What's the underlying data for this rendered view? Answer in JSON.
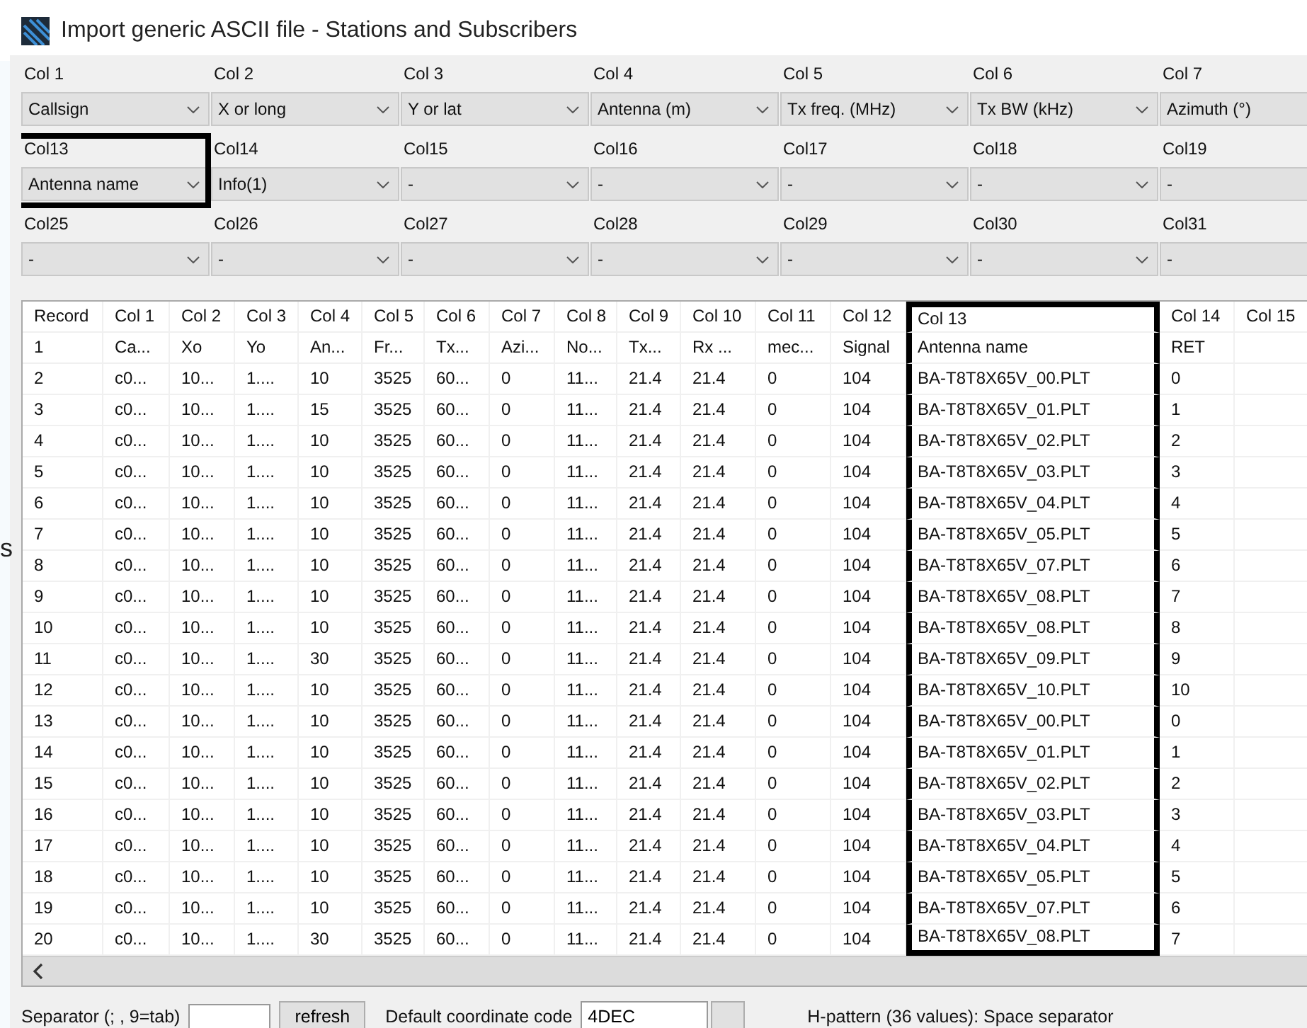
{
  "background_text": "s",
  "window": {
    "title": "Import generic ASCII file - Stations and Subscribers"
  },
  "column_mapping": [
    {
      "label": "Col 1",
      "value": "Callsign",
      "highlighted": false
    },
    {
      "label": "Col 2",
      "value": "X or long",
      "highlighted": false
    },
    {
      "label": "Col 3",
      "value": "Y or lat",
      "highlighted": false
    },
    {
      "label": "Col 4",
      "value": "Antenna (m)",
      "highlighted": false
    },
    {
      "label": "Col 5",
      "value": "Tx freq. (MHz)",
      "highlighted": false
    },
    {
      "label": "Col 6",
      "value": "Tx BW (kHz)",
      "highlighted": false
    },
    {
      "label": "Col 7",
      "value": "Azimuth (°)",
      "highlighted": false
    },
    {
      "label": "Col13",
      "value": "Antenna name",
      "highlighted": true
    },
    {
      "label": "Col14",
      "value": "Info(1)",
      "highlighted": false
    },
    {
      "label": "Col15",
      "value": "-",
      "highlighted": false
    },
    {
      "label": "Col16",
      "value": "-",
      "highlighted": false
    },
    {
      "label": "Col17",
      "value": "-",
      "highlighted": false
    },
    {
      "label": "Col18",
      "value": "-",
      "highlighted": false
    },
    {
      "label": "Col19",
      "value": "-",
      "highlighted": false
    },
    {
      "label": "Col25",
      "value": "-",
      "highlighted": false
    },
    {
      "label": "Col26",
      "value": "-",
      "highlighted": false
    },
    {
      "label": "Col27",
      "value": "-",
      "highlighted": false
    },
    {
      "label": "Col28",
      "value": "-",
      "highlighted": false
    },
    {
      "label": "Col29",
      "value": "-",
      "highlighted": false
    },
    {
      "label": "Col30",
      "value": "-",
      "highlighted": false
    },
    {
      "label": "Col31",
      "value": "-",
      "highlighted": false
    }
  ],
  "table": {
    "columns": [
      {
        "label": "Record",
        "highlighted": false
      },
      {
        "label": "Col 1",
        "highlighted": false
      },
      {
        "label": "Col 2",
        "highlighted": false
      },
      {
        "label": "Col 3",
        "highlighted": false
      },
      {
        "label": "Col 4",
        "highlighted": false
      },
      {
        "label": "Col 5",
        "highlighted": false
      },
      {
        "label": "Col 6",
        "highlighted": false
      },
      {
        "label": "Col 7",
        "highlighted": false
      },
      {
        "label": "Col 8",
        "highlighted": false
      },
      {
        "label": "Col 9",
        "highlighted": false
      },
      {
        "label": "Col 10",
        "highlighted": false
      },
      {
        "label": "Col 11",
        "highlighted": false
      },
      {
        "label": "Col 12",
        "highlighted": false
      },
      {
        "label": "Col 13",
        "highlighted": true
      },
      {
        "label": "Col 14",
        "highlighted": false
      },
      {
        "label": "Col 15",
        "highlighted": false
      }
    ],
    "rows": [
      [
        "1",
        "Ca...",
        "Xo",
        "Yo",
        "An...",
        "Fr...",
        "Tx...",
        "Azi...",
        "No...",
        "Tx...",
        "Rx ...",
        "mec...",
        "Signal",
        "Antenna name",
        "RET"
      ],
      [
        "2",
        "c0...",
        "10...",
        "1....",
        "10",
        "3525",
        "60...",
        "0",
        "11...",
        "21.4",
        "21.4",
        "0",
        "104",
        "BA-T8T8X65V_00.PLT",
        "0"
      ],
      [
        "3",
        "c0...",
        "10...",
        "1....",
        "15",
        "3525",
        "60...",
        "0",
        "11...",
        "21.4",
        "21.4",
        "0",
        "104",
        "BA-T8T8X65V_01.PLT",
        "1"
      ],
      [
        "4",
        "c0...",
        "10...",
        "1....",
        "10",
        "3525",
        "60...",
        "0",
        "11...",
        "21.4",
        "21.4",
        "0",
        "104",
        "BA-T8T8X65V_02.PLT",
        "2"
      ],
      [
        "5",
        "c0...",
        "10...",
        "1....",
        "10",
        "3525",
        "60...",
        "0",
        "11...",
        "21.4",
        "21.4",
        "0",
        "104",
        "BA-T8T8X65V_03.PLT",
        "3"
      ],
      [
        "6",
        "c0...",
        "10...",
        "1....",
        "10",
        "3525",
        "60...",
        "0",
        "11...",
        "21.4",
        "21.4",
        "0",
        "104",
        "BA-T8T8X65V_04.PLT",
        "4"
      ],
      [
        "7",
        "c0...",
        "10...",
        "1....",
        "10",
        "3525",
        "60...",
        "0",
        "11...",
        "21.4",
        "21.4",
        "0",
        "104",
        "BA-T8T8X65V_05.PLT",
        "5"
      ],
      [
        "8",
        "c0...",
        "10...",
        "1....",
        "10",
        "3525",
        "60...",
        "0",
        "11...",
        "21.4",
        "21.4",
        "0",
        "104",
        "BA-T8T8X65V_07.PLT",
        "6"
      ],
      [
        "9",
        "c0...",
        "10...",
        "1....",
        "10",
        "3525",
        "60...",
        "0",
        "11...",
        "21.4",
        "21.4",
        "0",
        "104",
        "BA-T8T8X65V_08.PLT",
        "7"
      ],
      [
        "10",
        "c0...",
        "10...",
        "1....",
        "10",
        "3525",
        "60...",
        "0",
        "11...",
        "21.4",
        "21.4",
        "0",
        "104",
        "BA-T8T8X65V_08.PLT",
        "8"
      ],
      [
        "11",
        "c0...",
        "10...",
        "1....",
        "30",
        "3525",
        "60...",
        "0",
        "11...",
        "21.4",
        "21.4",
        "0",
        "104",
        "BA-T8T8X65V_09.PLT",
        "9"
      ],
      [
        "12",
        "c0...",
        "10...",
        "1....",
        "10",
        "3525",
        "60...",
        "0",
        "11...",
        "21.4",
        "21.4",
        "0",
        "104",
        "BA-T8T8X65V_10.PLT",
        "10"
      ],
      [
        "13",
        "c0...",
        "10...",
        "1....",
        "10",
        "3525",
        "60...",
        "0",
        "11...",
        "21.4",
        "21.4",
        "0",
        "104",
        "BA-T8T8X65V_00.PLT",
        "0"
      ],
      [
        "14",
        "c0...",
        "10...",
        "1....",
        "10",
        "3525",
        "60...",
        "0",
        "11...",
        "21.4",
        "21.4",
        "0",
        "104",
        "BA-T8T8X65V_01.PLT",
        "1"
      ],
      [
        "15",
        "c0...",
        "10...",
        "1....",
        "10",
        "3525",
        "60...",
        "0",
        "11...",
        "21.4",
        "21.4",
        "0",
        "104",
        "BA-T8T8X65V_02.PLT",
        "2"
      ],
      [
        "16",
        "c0...",
        "10...",
        "1....",
        "10",
        "3525",
        "60...",
        "0",
        "11...",
        "21.4",
        "21.4",
        "0",
        "104",
        "BA-T8T8X65V_03.PLT",
        "3"
      ],
      [
        "17",
        "c0...",
        "10...",
        "1....",
        "10",
        "3525",
        "60...",
        "0",
        "11...",
        "21.4",
        "21.4",
        "0",
        "104",
        "BA-T8T8X65V_04.PLT",
        "4"
      ],
      [
        "18",
        "c0...",
        "10...",
        "1....",
        "10",
        "3525",
        "60...",
        "0",
        "11...",
        "21.4",
        "21.4",
        "0",
        "104",
        "BA-T8T8X65V_05.PLT",
        "5"
      ],
      [
        "19",
        "c0...",
        "10...",
        "1....",
        "10",
        "3525",
        "60...",
        "0",
        "11...",
        "21.4",
        "21.4",
        "0",
        "104",
        "BA-T8T8X65V_07.PLT",
        "6"
      ],
      [
        "20",
        "c0...",
        "10...",
        "1....",
        "30",
        "3525",
        "60...",
        "0",
        "11...",
        "21.4",
        "21.4",
        "0",
        "104",
        "BA-T8T8X65V_08.PLT",
        "7"
      ]
    ]
  },
  "bottom_bar": {
    "separator_label": "Separator (; , 9=tab)",
    "refresh_button": "refresh",
    "coordinate_label": "Default coordinate code",
    "coordinate_value": "4DEC",
    "pattern_note": "H-pattern (36 values): Space separator"
  }
}
